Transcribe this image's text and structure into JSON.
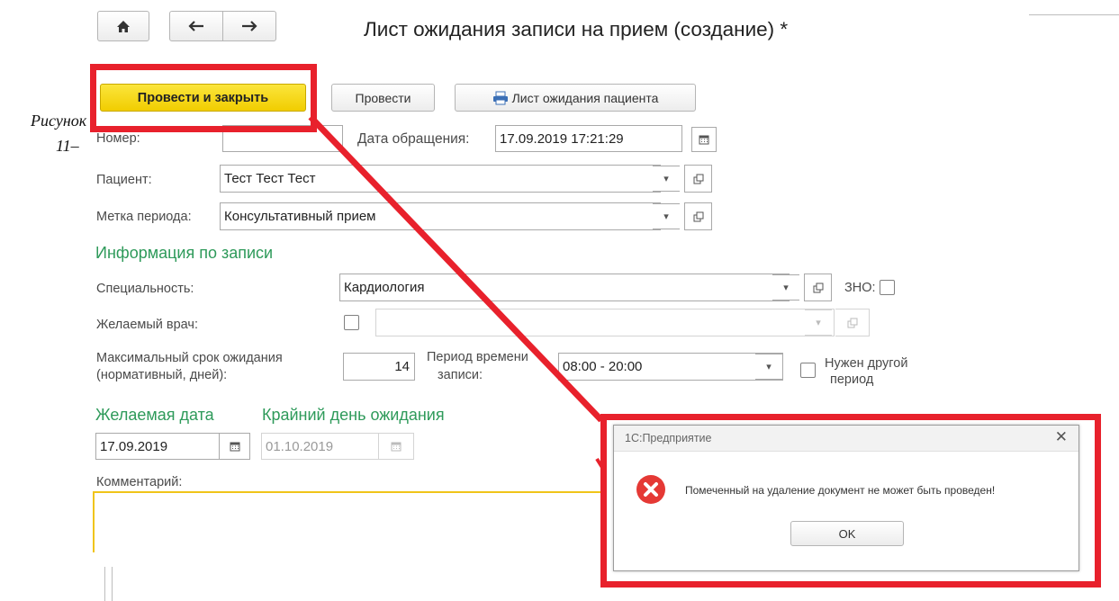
{
  "caption": {
    "word": "Рисунок",
    "number": "11–"
  },
  "nav": {
    "home_icon": "home-icon",
    "back_icon": "arrow-left-icon",
    "forward_icon": "arrow-right-icon"
  },
  "title": "Лист ожидания записи на прием (создание) *",
  "toolbar": {
    "post_close": "Провести и закрыть",
    "post": "Провести",
    "print_label": "Лист ожидания пациента"
  },
  "form": {
    "number_label": "Номер:",
    "number_value": "",
    "date_label": "Дата обращения:",
    "date_value": "17.09.2019 17:21:29",
    "patient_label": "Пациент:",
    "patient_value": "Тест Тест Тест",
    "period_label": "Метка периода:",
    "period_value": "Консультативный прием",
    "section_title": "Информация по записи",
    "specialty_label": "Специальность:",
    "specialty_value": "Кардиология",
    "zno_label": "ЗНО:",
    "doctor_label": "Желаемый врач:",
    "doctor_value": "",
    "maxwait_label_1": "Максимальный срок ожидания",
    "maxwait_label_2": "(нормативный, дней):",
    "maxwait_value": "14",
    "timeperiod_label_1": "Период времени",
    "timeperiod_label_2": "записи:",
    "timeperiod_value": "08:00 - 20:00",
    "other_period_1": "Нужен другой",
    "other_period_2": "период",
    "desired_date_title": "Желаемая дата",
    "deadline_title": "Крайний день ожидания",
    "desired_date_value": "17.09.2019",
    "deadline_value": "01.10.2019",
    "comment_label": "Комментарий:"
  },
  "dialog": {
    "title": "1С:Предприятие",
    "message": "Помеченный на удаление документ не может быть проведен!",
    "ok": "OK"
  },
  "colors": {
    "highlight_red": "#e8212c",
    "primary_yellow": "#f5d90a",
    "section_green": "#2e9a5a",
    "error_red": "#e53935"
  }
}
